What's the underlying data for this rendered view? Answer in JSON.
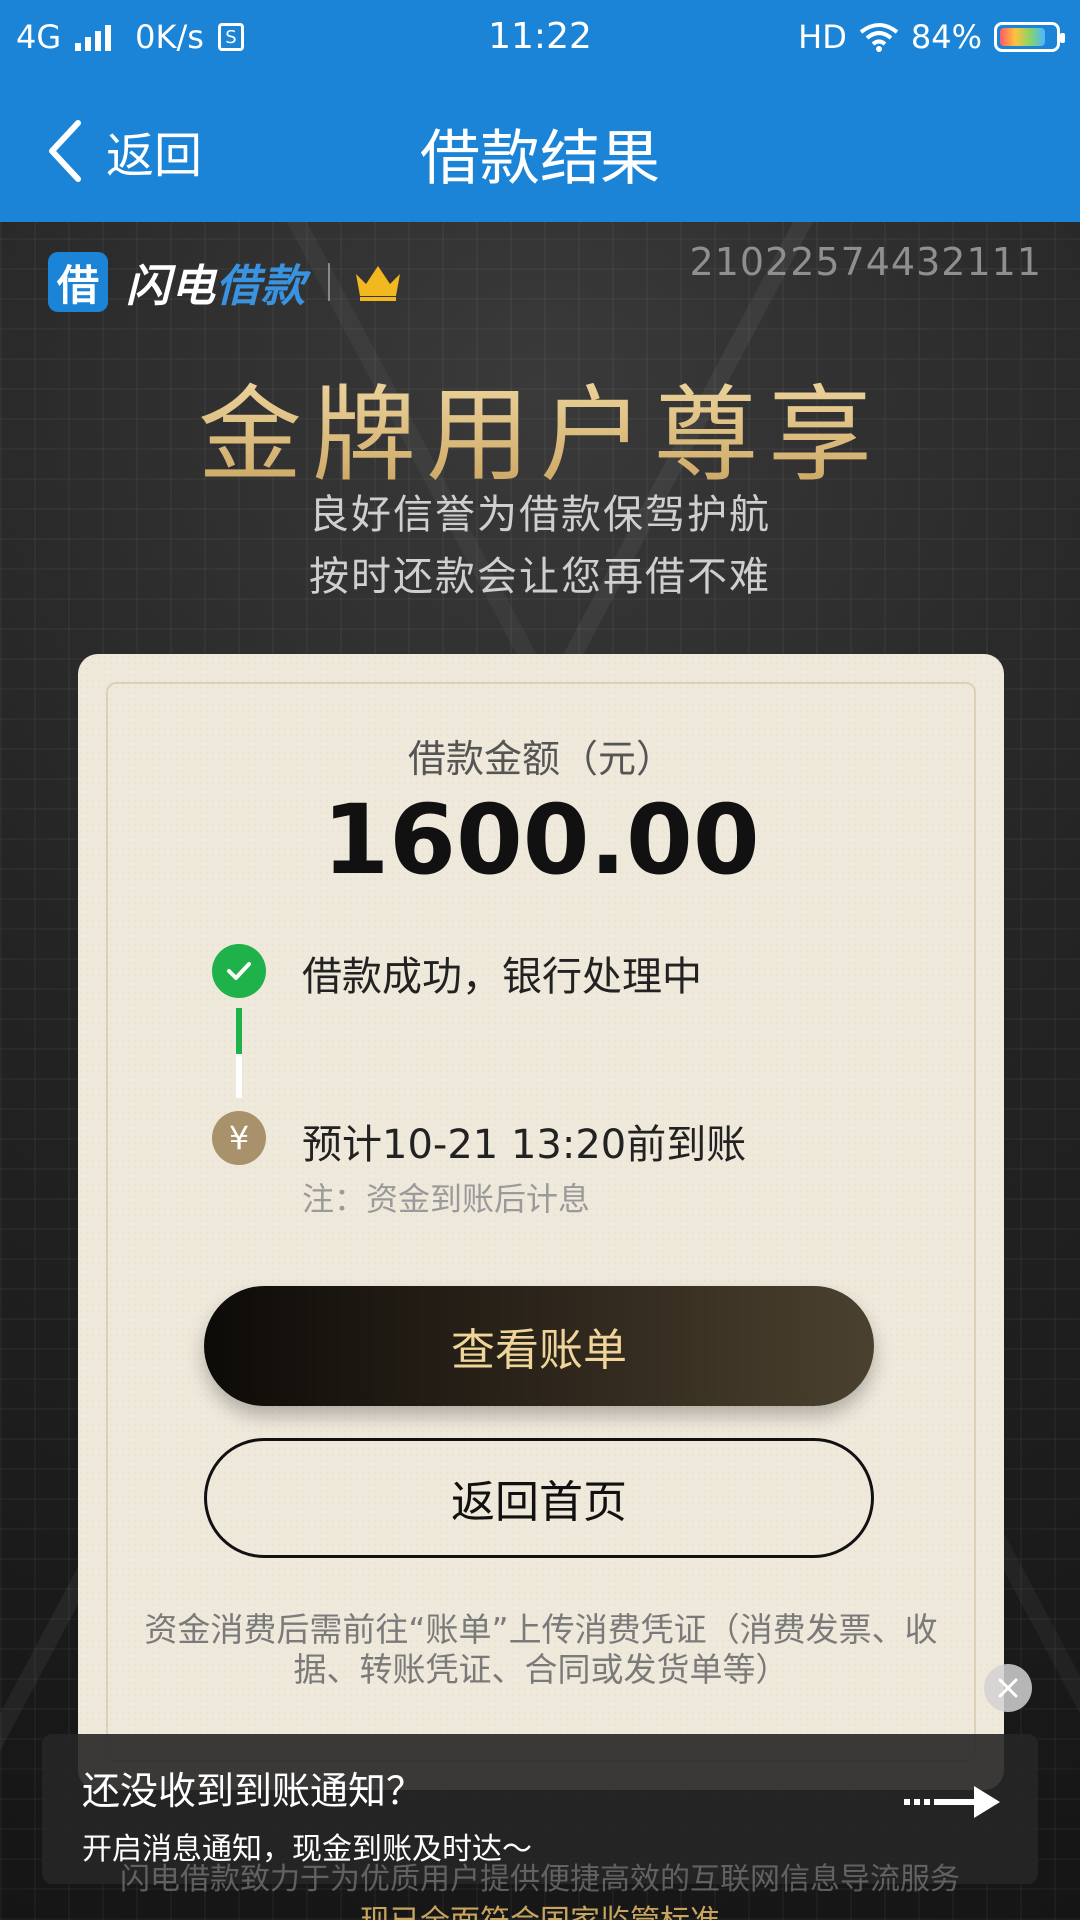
{
  "status_bar": {
    "network": "4G",
    "speed": "0K/s",
    "time": "11:22",
    "hd": "HD",
    "battery_percent": "84%",
    "battery_level": 0.84
  },
  "title_bar": {
    "back_label": "返回",
    "title": "借款结果"
  },
  "hero": {
    "logo_char": "借",
    "brand_prefix": "闪电",
    "brand_suffix": "借款",
    "order_number": "21022574432111",
    "gold_title": "金牌用户尊享",
    "slogan_line1": "良好信誉为借款保驾护航",
    "slogan_line2": "按时还款会让您再借不难"
  },
  "card": {
    "amount_label": "借款金额（元）",
    "amount_value": "1600.00",
    "step1_text": "借款成功，银行处理中",
    "step2_icon": "¥",
    "step2_text": "预计10-21 13:20前到账",
    "step2_note": "注：资金到账后计息",
    "primary_button": "查看账单",
    "secondary_button": "返回首页",
    "notice": "资金消费后需前往“账单”上传消费凭证（消费发票、收据、转账凭证、合同或发货单等）"
  },
  "popup": {
    "title": "还没收到到账通知？",
    "subtitle": "开启消息通知，现金到账及时达～"
  },
  "footer": {
    "line1": "闪电借款致力于为优质用户提供便捷高效的互联网信息导流服务",
    "line2": "现已全面符合国家监管标准"
  },
  "colors": {
    "brand_blue": "#1b84d6",
    "gold": "#e9cf92",
    "success_green": "#1fb14a"
  },
  "icons": [
    "signal-icon",
    "sim-icon",
    "wifi-icon",
    "battery-icon",
    "back-chevron-icon",
    "crown-icon",
    "check-icon",
    "yuan-icon",
    "close-icon",
    "arrow-right-icon"
  ]
}
